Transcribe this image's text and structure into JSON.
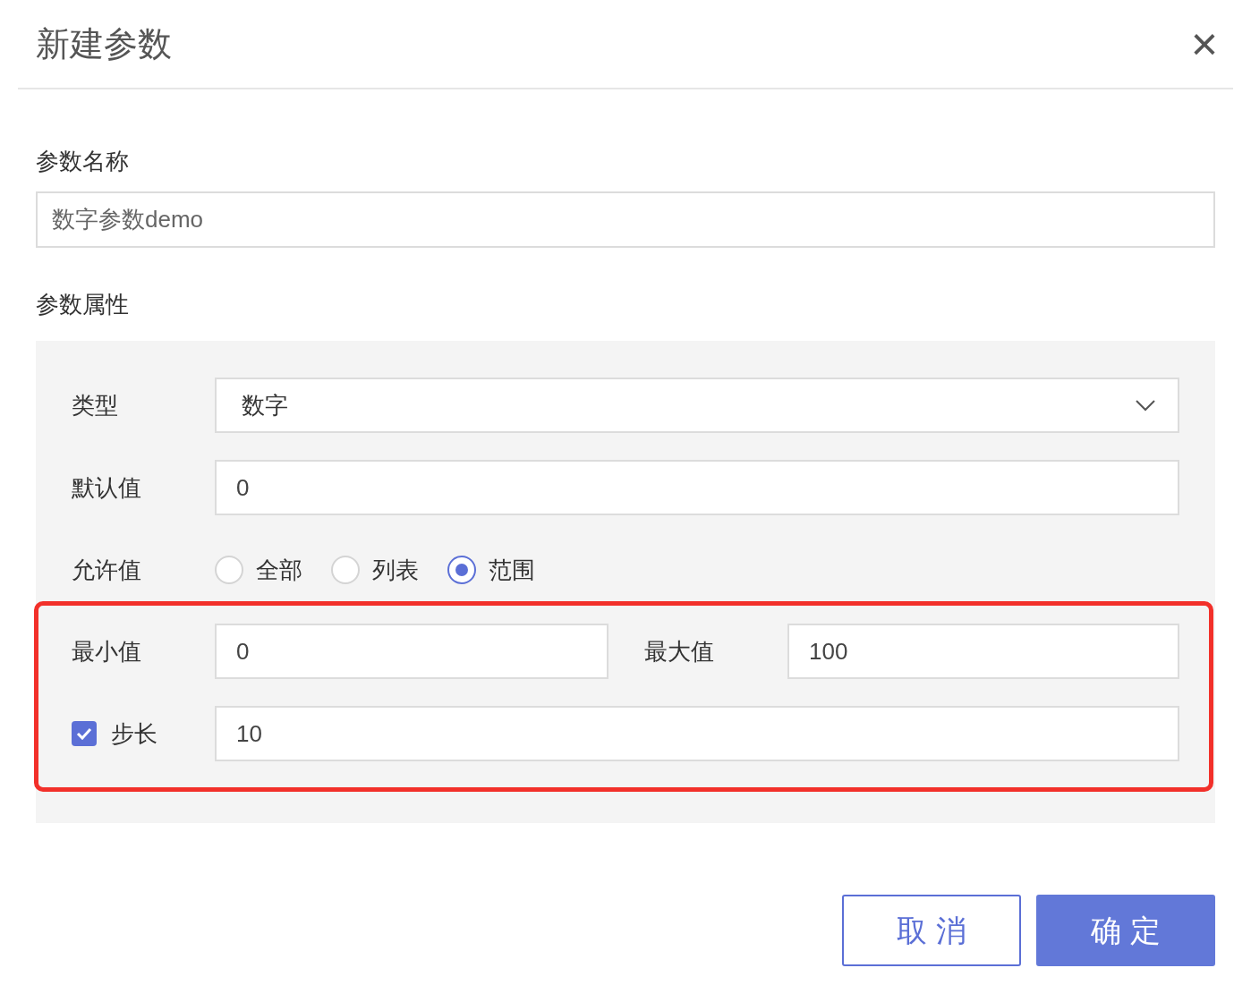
{
  "dialog": {
    "title": "新建参数",
    "close": "×"
  },
  "name_field": {
    "label": "参数名称",
    "value": "数字参数demo"
  },
  "attributes": {
    "label": "参数属性",
    "type": {
      "label": "类型",
      "value": "数字"
    },
    "default": {
      "label": "默认值",
      "value": "0"
    },
    "allowed": {
      "label": "允许值",
      "options": [
        {
          "label": "全部",
          "selected": false
        },
        {
          "label": "列表",
          "selected": false
        },
        {
          "label": "范围",
          "selected": true
        }
      ]
    },
    "range": {
      "highlighted": true,
      "min": {
        "label": "最小值",
        "value": "0"
      },
      "max": {
        "label": "最大值",
        "value": "100"
      },
      "step": {
        "label": "步长",
        "checked": true,
        "value": "10"
      }
    }
  },
  "buttons": [
    {
      "label": "取 消",
      "kind": "secondary"
    },
    {
      "label": "确 定",
      "kind": "primary"
    }
  ]
}
